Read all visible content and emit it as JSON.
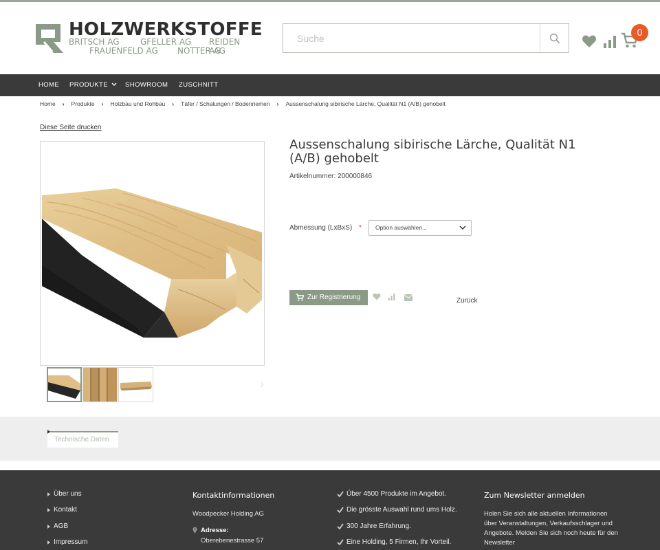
{
  "brand": {
    "title": "HOLZWERKSTOFFE",
    "companies": [
      "BRITSCH AG",
      "GFELLER AG",
      "REIDEN AG",
      "FRAUENFELD AG",
      "NOTTER AG"
    ],
    "accent": "#8a9a86",
    "dark": "#3a3a3a",
    "badge_color": "#e85b26"
  },
  "header": {
    "search_placeholder": "Suche",
    "cart_count": "0",
    "icons": [
      "search-icon",
      "heart-icon",
      "bar-chart-icon",
      "cart-icon"
    ]
  },
  "nav": {
    "items": [
      "HOME",
      "PRODUKTE",
      "SHOWROOM",
      "ZUSCHNITT"
    ]
  },
  "breadcrumb": [
    "Home",
    "Produkte",
    "Holzbau und Rohbau",
    "Täfer / Schalungen / Bodenriemen",
    "Aussenschalung sibirische Lärche, Qualität N1 (A/B) gehobelt"
  ],
  "page": {
    "print_label": "Diese Seite drucken"
  },
  "product": {
    "title": "Aussenschalung sibirische Lärche, Qualität N1 (A/B) gehobelt",
    "sku_label": "Artikelnummer:",
    "sku": "200000846",
    "option_label": "Abmessung (LxBxS)",
    "option_required": "*",
    "option_value": "Option auswählen...",
    "register_label": "Zur Registrierung",
    "back_label": "Zurück"
  },
  "tabs": {
    "technical": "Technische Daten"
  },
  "footer": {
    "links": [
      "Über uns",
      "Kontakt",
      "AGB",
      "Impressum"
    ],
    "contact_heading": "Kontaktinformationen",
    "company": "Woodpecker Holding AG",
    "address_label": "Adresse:",
    "address_line1": "Oberebenestrasse 57",
    "usps": [
      "Über 4500 Produkte im Angebot.",
      "Die grösste Auswahl rund ums Holz.",
      "300 Jahre Erfahrung.",
      "Eine Holding, 5 Firmen, Ihr Vorteil."
    ],
    "newsletter_heading": "Zum Newsletter anmelden",
    "newsletter_text": "Holen Sie sich alle aktuellen Informationen über Veranstaltungen, Verkaufsschlager und Angebote. Melden Sie sich noch heute für den Newsletter"
  }
}
